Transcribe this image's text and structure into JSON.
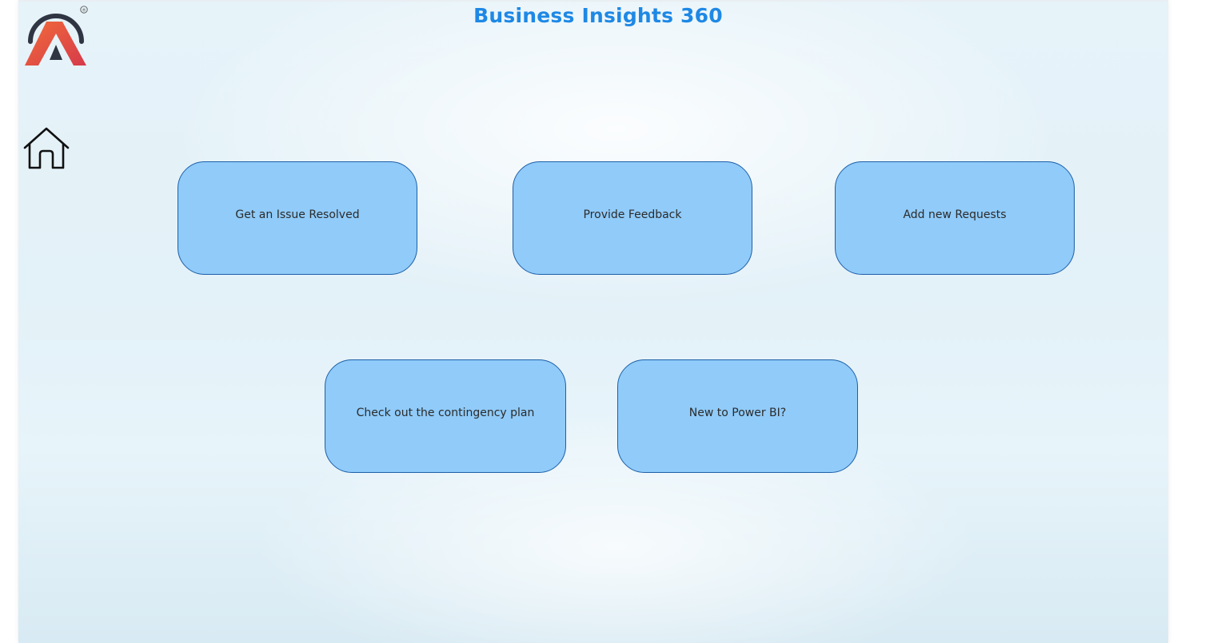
{
  "header": {
    "title": "Business Insights 360",
    "title_color": "#1e88e5"
  },
  "logo": {
    "icon": "brand-logo-icon",
    "registered_mark": "®"
  },
  "nav": {
    "home_icon": "home-icon"
  },
  "tiles": [
    {
      "label": "Get an Issue Resolved"
    },
    {
      "label": "Provide Feedback"
    },
    {
      "label": "Add new Requests"
    },
    {
      "label": "Check out the contingency plan"
    },
    {
      "label": "New to Power BI?"
    }
  ],
  "colors": {
    "tile_fill": "#90cbf9",
    "tile_border": "#1c5fa8",
    "background": "#e4f2f9"
  }
}
